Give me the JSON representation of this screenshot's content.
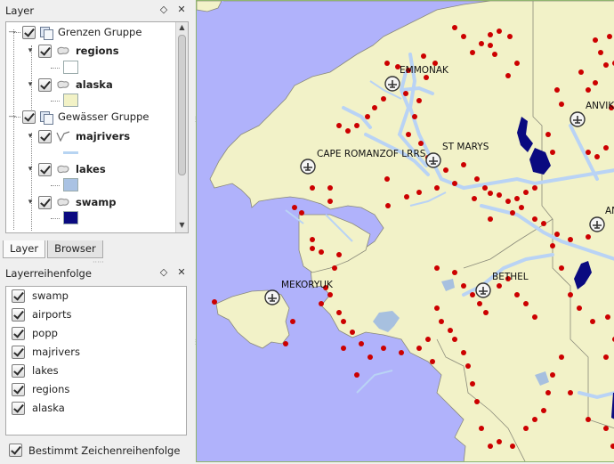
{
  "layer_panel": {
    "title": "Layer",
    "float_icon": "◇",
    "close_icon": "✕",
    "groups": [
      {
        "name": "Grenzen Gruppe",
        "layers": [
          {
            "name": "regions",
            "swatch": "#ffffff"
          },
          {
            "name": "alaska",
            "swatch": "#f2f2c6"
          }
        ]
      },
      {
        "name": "Gewässer Gruppe",
        "layers": [
          {
            "name": "majrivers",
            "swatch": "#b7d4f2"
          },
          {
            "name": "lakes",
            "swatch": "#a9c2e3"
          },
          {
            "name": "swamp",
            "swatch": "#0a0a80"
          }
        ]
      }
    ],
    "scroll_up": "▲",
    "scroll_down": "▼"
  },
  "tabs": [
    {
      "label": "Layer",
      "active": true
    },
    {
      "label": "Browser",
      "active": false
    }
  ],
  "order_panel": {
    "title": "Layerreihenfolge",
    "float_icon": "◇",
    "close_icon": "✕",
    "items": [
      "swamp",
      "airports",
      "popp",
      "majrivers",
      "lakes",
      "regions",
      "alaska"
    ],
    "footer_checkbox": "Bestimmt Zeichenreihenfolge"
  },
  "map": {
    "colors": {
      "water": "#b0b2fb",
      "land": "#f2f2c8",
      "border": "#8a8a7a",
      "river": "#b9d3f5",
      "lake": "#a7c0df",
      "swamp": "#0a0a80",
      "point": "#cc0000"
    },
    "labels": [
      "EMMONAK",
      "ANVIK",
      "CAPE ROMANZOF LRRS",
      "ST MARYS",
      "MEKORYUK",
      "BETHEL",
      "AN"
    ]
  }
}
